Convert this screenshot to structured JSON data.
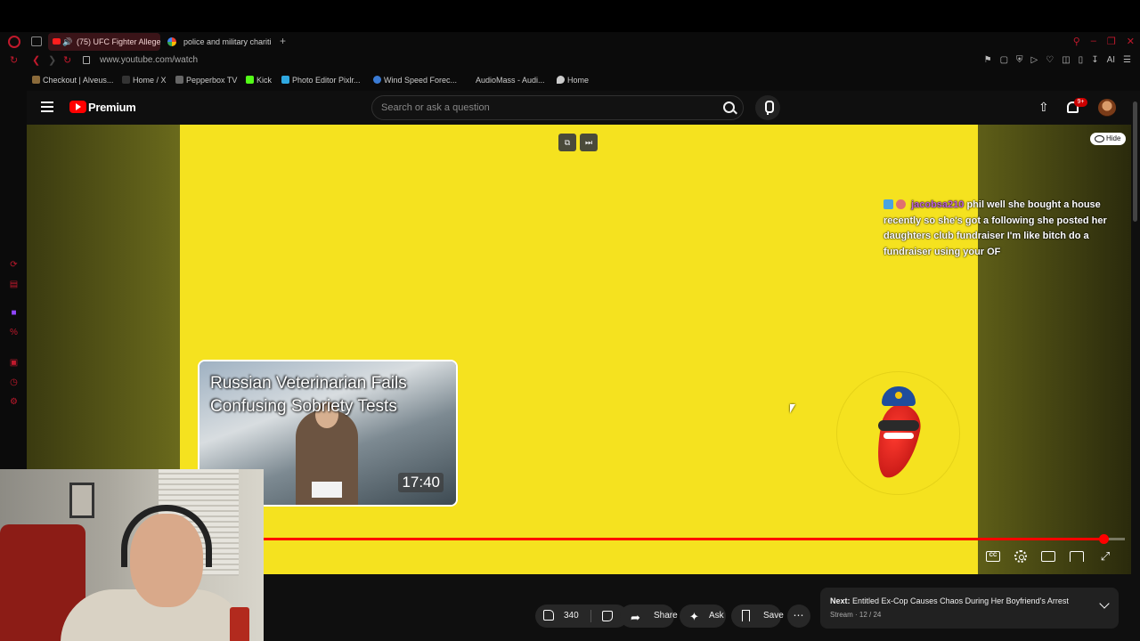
{
  "browser": {
    "tabs": [
      {
        "label": "(75) UFC Fighter Allege",
        "active": true
      },
      {
        "label": "police and military charitie",
        "active": false
      }
    ],
    "url": "www.youtube.com/watch",
    "bookmarks": [
      {
        "label": "Checkout | Alveus...",
        "icon": "bookmark-icon"
      },
      {
        "label": "Home / X",
        "icon": "x-icon"
      },
      {
        "label": "Pepperbox TV",
        "icon": "tv-icon"
      },
      {
        "label": "Kick",
        "icon": "kick-icon"
      },
      {
        "label": "Photo Editor Pixlr...",
        "icon": "photo-icon"
      },
      {
        "label": "Wind Speed Forec...",
        "icon": "wind-icon"
      },
      {
        "label": "AudioMass - Audi...",
        "icon": ""
      },
      {
        "label": "Home",
        "icon": "location-icon"
      }
    ],
    "ai_label": "AI"
  },
  "youtube": {
    "brand": "Premium",
    "search_placeholder": "Search or ask a question",
    "notification_count": "9+"
  },
  "player": {
    "hide_label": "Hide",
    "chat": {
      "user": "jacobsa210",
      "message": "phil well she bought a house recently so she's got a following she posted her daughters club fundraiser I'm like bitch do a fundraiser using your OF"
    },
    "thumbnail": {
      "title": "Russian Veterinarian Fails Confusing Sobriety Tests",
      "duration": "17:40"
    },
    "progress": 0.975,
    "colors": {
      "stage": "#f5e21f",
      "progress": "#ff0000"
    }
  },
  "actions": {
    "like_count": "340",
    "share_label": "Share",
    "ask_label": "Ask",
    "save_label": "Save"
  },
  "next_up": {
    "prefix": "Next:",
    "title": "Entitled Ex-Cop Causes Chaos During Her Boyfriend's Arrest",
    "subtitle": "Stream · 12 / 24"
  }
}
